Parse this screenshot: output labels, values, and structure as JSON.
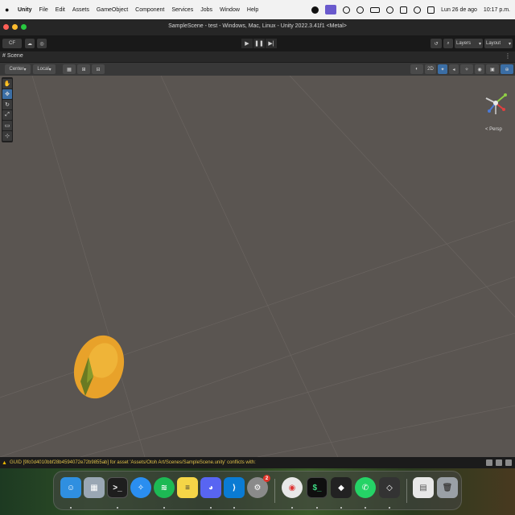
{
  "menubar": {
    "app_name": "Unity",
    "items": [
      "File",
      "Edit",
      "Assets",
      "GameObject",
      "Component",
      "Services",
      "Jobs",
      "Window",
      "Help"
    ],
    "date": "Lun 26 de ago",
    "time": "10:17 p.m."
  },
  "window": {
    "title": "SampleScene - test - Windows, Mac, Linux - Unity 2022.3.41f1 <Metal>"
  },
  "toolbar": {
    "account_label": "CF",
    "layers_label": "Layers",
    "layout_label": "Layout"
  },
  "scene_tab": {
    "label": "Scene",
    "pivot_label": "Center",
    "space_label": "Local",
    "mode_2d": "2D",
    "persp_label": "< Persp"
  },
  "statusbar": {
    "message": "GUID [9fc0d4010bbf28b4594072e72b9855ab] for asset 'Assets/Otoh Art/Scenes/SampleScene.unity' conflicts with:"
  },
  "dock": {
    "apps": [
      {
        "name": "Finder",
        "icon": "finder-icon",
        "color": "#2f8fe0"
      },
      {
        "name": "Launchpad",
        "icon": "launchpad-icon",
        "color": "#9aa7b4"
      },
      {
        "name": "Terminal",
        "icon": "terminal-icon",
        "color": "#1e1e1e"
      },
      {
        "name": "Safari",
        "icon": "safari-icon",
        "color": "#2a8ef0"
      },
      {
        "name": "Spotify",
        "icon": "spotify-icon",
        "color": "#1db954"
      },
      {
        "name": "Notes",
        "icon": "notes-icon",
        "color": "#f5d547"
      },
      {
        "name": "Discord",
        "icon": "discord-icon",
        "color": "#5865f2"
      },
      {
        "name": "Visual Studio Code",
        "icon": "vscode-icon",
        "color": "#0a7bd3"
      },
      {
        "name": "System Settings",
        "icon": "settings-icon",
        "color": "#8a8a8a",
        "badge": "2"
      },
      {
        "name": "Chrome",
        "icon": "chrome-icon",
        "color": "#e8e8e8"
      },
      {
        "name": "Terminal",
        "icon": "terminal-dark-icon",
        "color": "#0f0f0f"
      },
      {
        "name": "Unity Hub",
        "icon": "unity-hub-icon",
        "color": "#222222"
      },
      {
        "name": "WhatsApp",
        "icon": "whatsapp-icon",
        "color": "#25d366"
      },
      {
        "name": "Unity",
        "icon": "unity-icon",
        "color": "#333333"
      },
      {
        "name": "Downloads",
        "icon": "document-icon",
        "color": "#e8e8e8"
      },
      {
        "name": "Trash",
        "icon": "trash-icon",
        "color": "#9aa0a6"
      }
    ]
  }
}
